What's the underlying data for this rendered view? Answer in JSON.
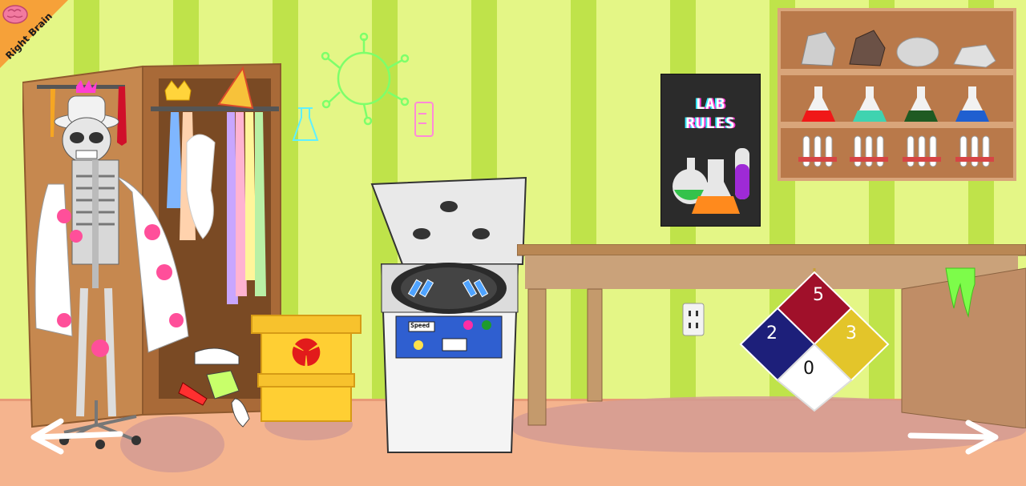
{
  "game": {
    "badge_label": "Right Brain",
    "poster": {
      "line1": "LAB",
      "line2": "RULES"
    },
    "centrifuge": {
      "speed_label": "Speed"
    },
    "hazard_diamond": {
      "health": "2",
      "flammability": "5",
      "reactivity": "3",
      "special": "0"
    },
    "colors": {
      "wall_light": "#e4f686",
      "wall_dark": "#bfe34a",
      "floor": "#f5b48e",
      "flask_red": "#f01818",
      "flask_teal": "#3fd3b0",
      "flask_green": "#1f5a22",
      "flask_blue": "#1f5fd0",
      "hazard_blue": "#1d1f7a",
      "hazard_red": "#a0102a",
      "hazard_yellow": "#e3c52a"
    },
    "nav": {
      "left": "arrow-left-icon",
      "right": "arrow-right-icon"
    }
  }
}
